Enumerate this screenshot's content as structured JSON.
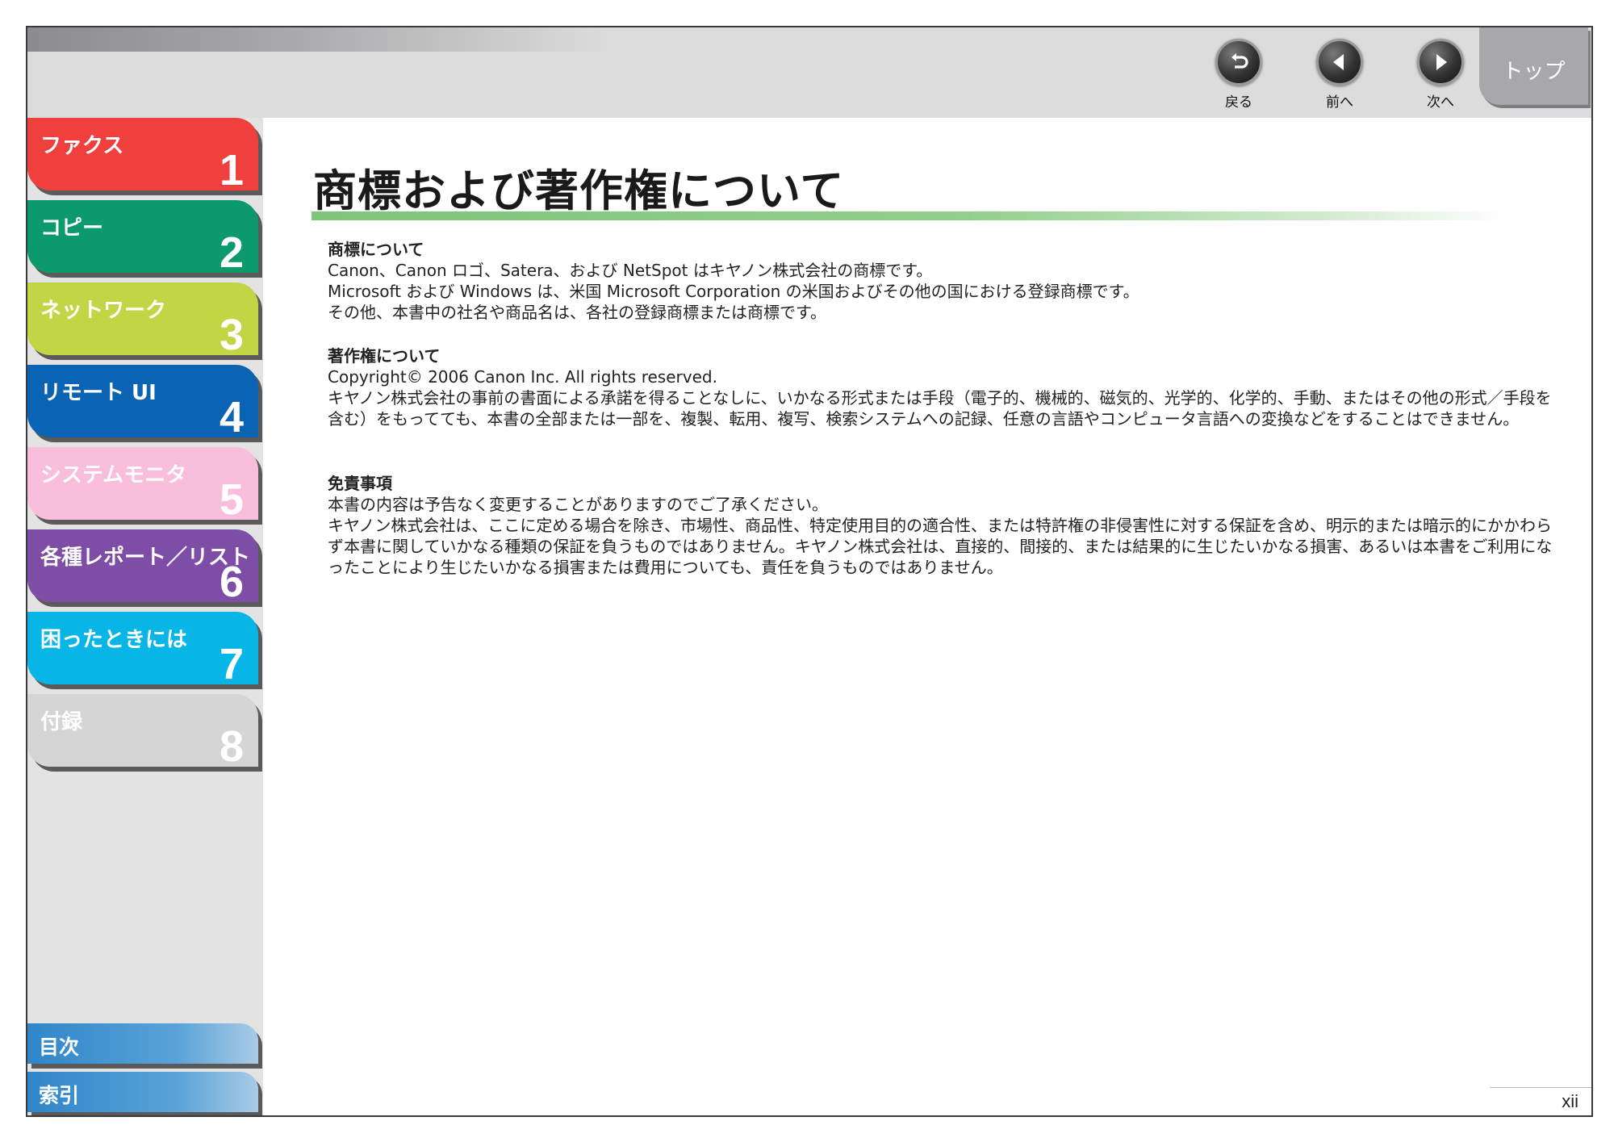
{
  "nav": {
    "back_label": "戻る",
    "prev_label": "前へ",
    "next_label": "次へ",
    "top_label": "トップ"
  },
  "sidebar": {
    "chapters": [
      {
        "title": "ファクス",
        "number": "1",
        "color": "#f0403e"
      },
      {
        "title": "コピー",
        "number": "2",
        "color": "#0c9a6c"
      },
      {
        "title": "ネットワーク",
        "number": "3",
        "color": "#c2d544"
      },
      {
        "title": "リモート UI",
        "number": "4",
        "color": "#0a63b3"
      },
      {
        "title": "システムモニタ",
        "number": "5",
        "color": "#f9bedc"
      },
      {
        "title": "各種レポート／リスト",
        "number": "6",
        "color": "#7e4ea6"
      },
      {
        "title": "困ったときには",
        "number": "7",
        "color": "#07b5e6"
      },
      {
        "title": "付録",
        "number": "8",
        "color": "#d5d5d6"
      }
    ],
    "contents_label": "目次",
    "index_label": "索引"
  },
  "page": {
    "title": "商標および著作権について",
    "page_number": "xii",
    "sections": [
      {
        "heading": "商標について",
        "lines": [
          "Canon、Canon ロゴ、Satera、および NetSpot はキヤノン株式会社の商標です。",
          "Microsoft および Windows は、米国 Microsoft Corporation の米国およびその他の国における登録商標です。",
          "その他、本書中の社名や商品名は、各社の登録商標または商標です。"
        ]
      },
      {
        "heading": "著作権について",
        "lines": [
          "Copyright© 2006 Canon Inc. All rights reserved.",
          "キヤノン株式会社の事前の書面による承諾を得ることなしに、いかなる形式または手段（電子的、機械的、磁気的、光学的、化学的、手動、またはその他の形式／手段を含む）をもってても、本書の全部または一部を、複製、転用、複写、検索システムへの記録、任意の言語やコンピュータ言語への変換などをすることはできません。"
        ]
      },
      {
        "heading": "免責事項",
        "lines": [
          "本書の内容は予告なく変更することがありますのでご了承ください。",
          "キヤノン株式会社は、ここに定める場合を除き、市場性、商品性、特定使用目的の適合性、または特許権の非侵害性に対する保証を含め、明示的または暗示的にかかわらず本書に関していかなる種類の保証を負うものではありません。キヤノン株式会社は、直接的、間接的、または結果的に生じたいかなる損害、あるいは本書をご利用になったことにより生じたいかなる損害または費用についても、責任を負うものではありません。"
        ]
      }
    ]
  }
}
